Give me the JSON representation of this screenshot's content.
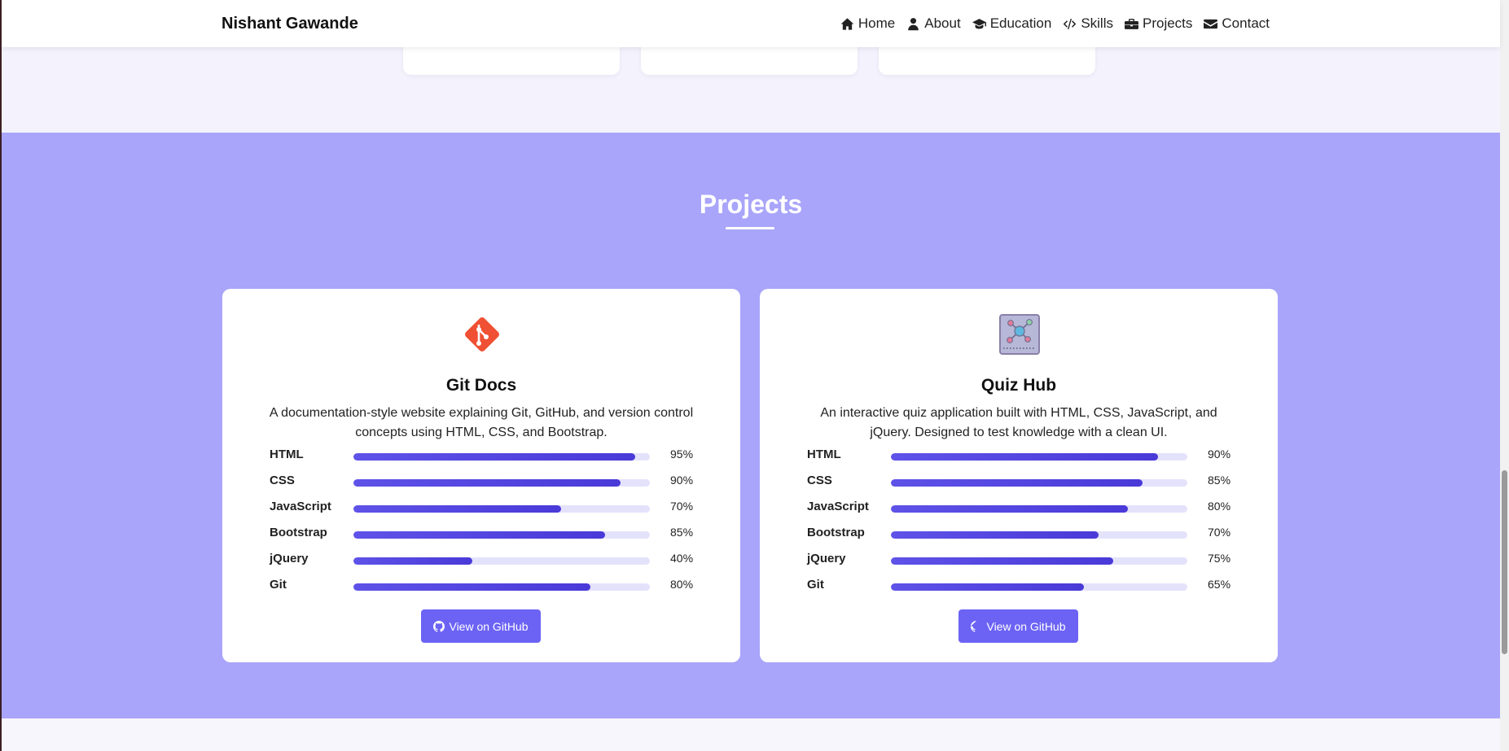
{
  "brand": "Nishant Gawande",
  "nav": [
    {
      "label": "Home",
      "icon": "home-icon"
    },
    {
      "label": "About",
      "icon": "user-icon"
    },
    {
      "label": "Education",
      "icon": "graduation-cap-icon"
    },
    {
      "label": "Skills",
      "icon": "code-icon"
    },
    {
      "label": "Projects",
      "icon": "briefcase-icon"
    },
    {
      "label": "Contact",
      "icon": "envelope-icon"
    }
  ],
  "projects": {
    "title": "Projects",
    "cards": [
      {
        "title": "Git Docs",
        "icon": "git-logo-icon",
        "description": "A documentation-style website explaining Git, GitHub, and version control concepts using HTML, CSS, and Bootstrap.",
        "skills": [
          {
            "name": "HTML",
            "level": 95,
            "label": "95%"
          },
          {
            "name": "CSS",
            "level": 90,
            "label": "90%"
          },
          {
            "name": "JavaScript",
            "level": 70,
            "label": "70%"
          },
          {
            "name": "Bootstrap",
            "level": 85,
            "label": "85%"
          },
          {
            "name": "jQuery",
            "level": 40,
            "label": "40%"
          },
          {
            "name": "Git",
            "level": 80,
            "label": "80%"
          }
        ],
        "button": "View on GitHub"
      },
      {
        "title": "Quiz Hub",
        "icon": "network-board-icon",
        "description": "An interactive quiz application built with HTML, CSS, JavaScript, and jQuery. Designed to test knowledge with a clean UI.",
        "skills": [
          {
            "name": "HTML",
            "level": 90,
            "label": "90%"
          },
          {
            "name": "CSS",
            "level": 85,
            "label": "85%"
          },
          {
            "name": "JavaScript",
            "level": 80,
            "label": "80%"
          },
          {
            "name": "Bootstrap",
            "level": 70,
            "label": "70%"
          },
          {
            "name": "jQuery",
            "level": 75,
            "label": "75%"
          },
          {
            "name": "Git",
            "level": 65,
            "label": "65%"
          }
        ],
        "button": "View on GitHub"
      }
    ]
  },
  "colors": {
    "section_bg": "#a9a5fa",
    "bar_fill": "#5e52e8",
    "bar_track": "#e4e2fb",
    "button_bg": "#6c63f5"
  }
}
